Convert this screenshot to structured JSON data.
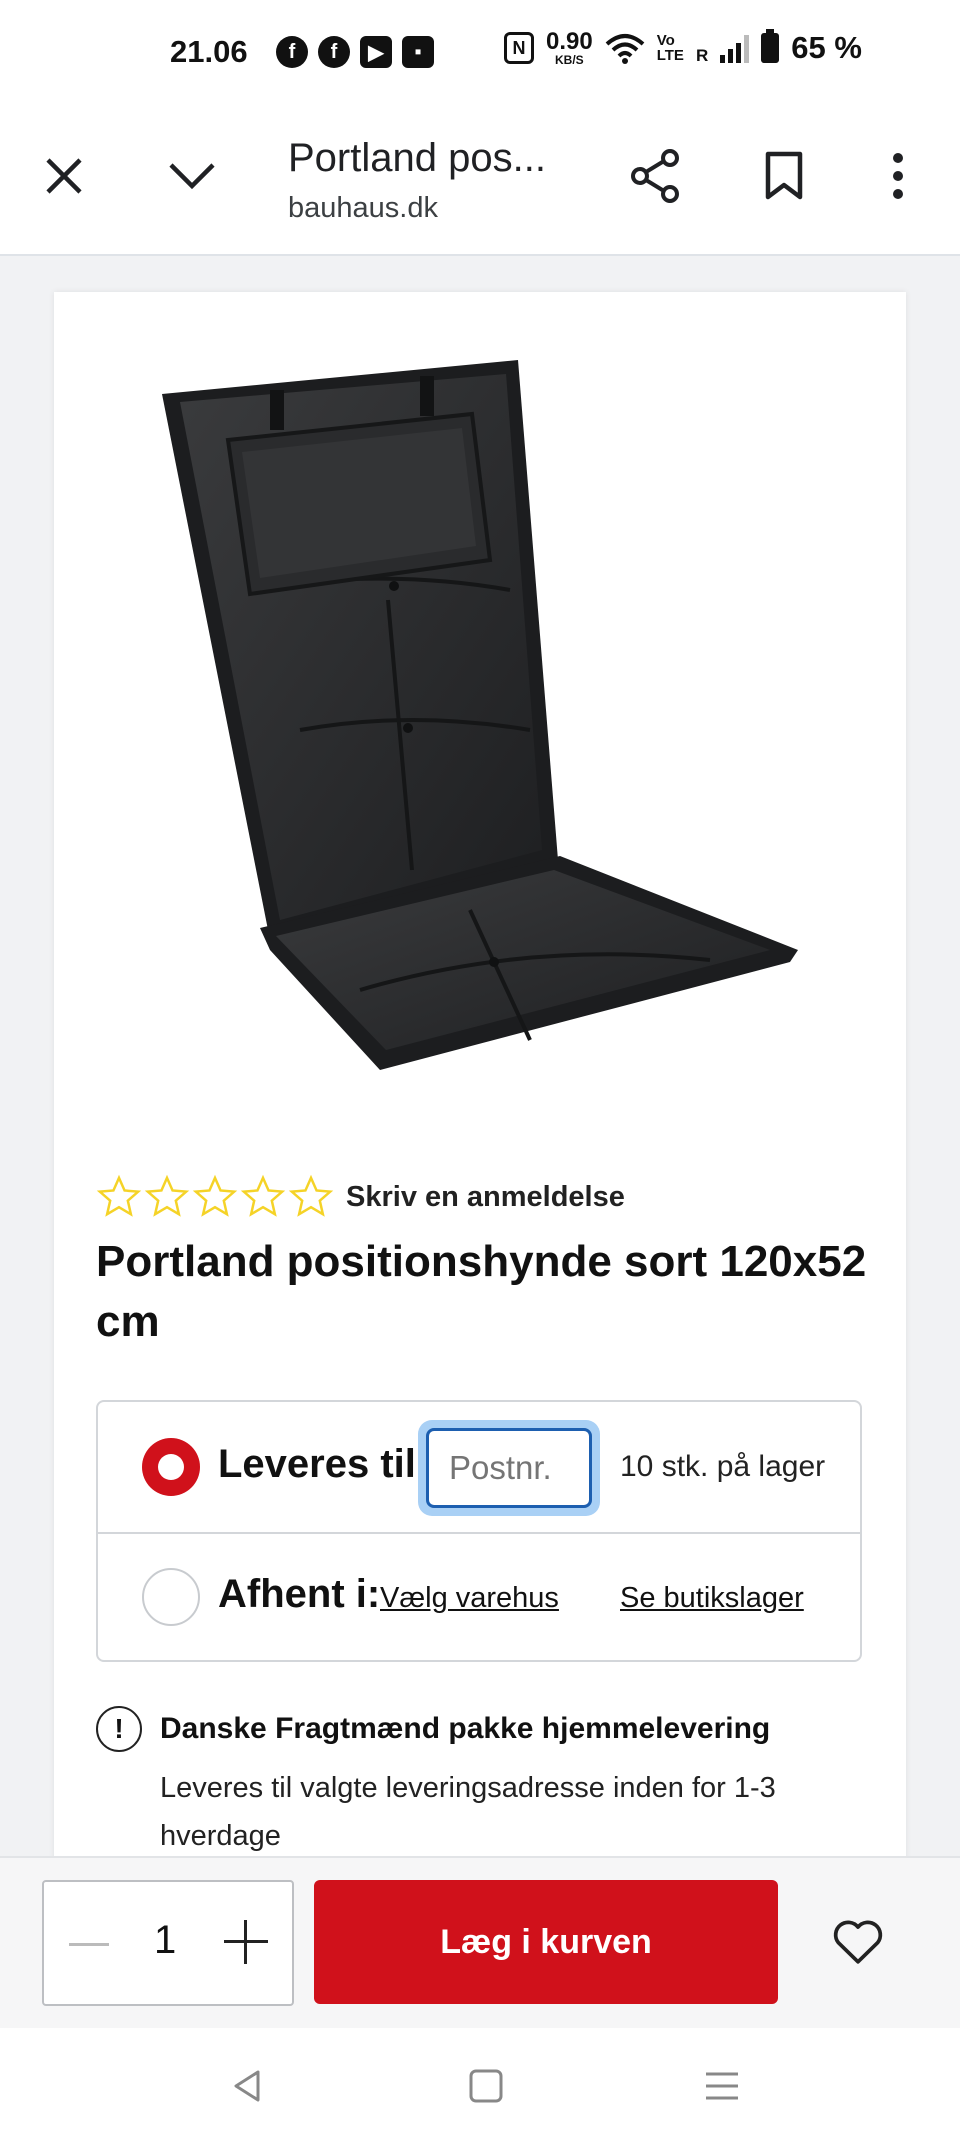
{
  "status_bar": {
    "time": "21.06",
    "speed_value": "0.90",
    "speed_unit": "KB/S",
    "volte_top": "Vo",
    "volte_bottom": "LTE",
    "roaming": "R",
    "battery": "65 %",
    "nfc_label": "N"
  },
  "browser": {
    "title": "Portland pos...",
    "url": "bauhaus.dk"
  },
  "product": {
    "review_link": "Skriv en anmeldelse",
    "title": "Portland positionshynde sort 120x52 cm",
    "rating_stars": 0,
    "star_color": "#f5d327"
  },
  "delivery": {
    "deliver_label": "Leveres til:",
    "postcode_placeholder": "Postnr.",
    "stock": "10 stk. på lager",
    "pickup_label": "Afhent i:",
    "choose_store": "Vælg varehus",
    "see_store_stock": "Se butikslager"
  },
  "shipping_info": {
    "icon": "!",
    "title": "Danske Fragtmænd pakke hjemmelevering",
    "text": "Leveres til valgte leveringsadresse inden for 1-3 hverdage"
  },
  "cart_bar": {
    "quantity": "1",
    "add_to_cart": "Læg i kurven",
    "accent": "#d0111b"
  }
}
